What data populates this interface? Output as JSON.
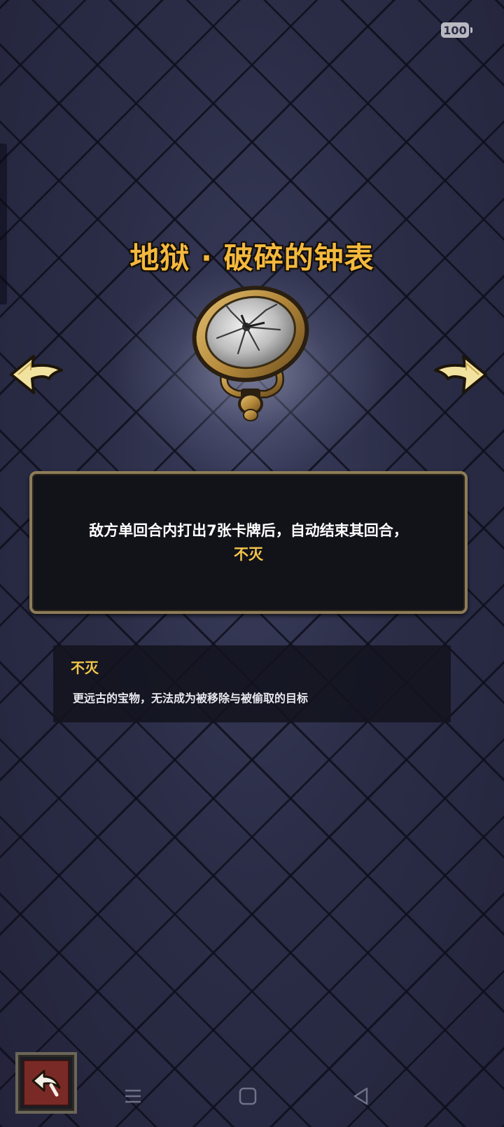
{
  "status_bar": {
    "battery": "100"
  },
  "relic": {
    "title": "地狱 · 破碎的钟表",
    "description": "敌方单回合内打出7张卡牌后，自动结束其回合，",
    "keyword_inline": "不灭"
  },
  "keyword_box": {
    "title": "不灭",
    "description": "更远古的宝物，无法成为被移除与被偷取的目标"
  },
  "icons": {
    "prev": "arrow-left-icon",
    "next": "arrow-right-icon",
    "back": "back-arrow-icon",
    "nav_menu": "menu-icon",
    "nav_home": "home-icon",
    "nav_back": "nav-back-icon"
  },
  "colors": {
    "title": "#f3b83d",
    "keyword": "#f3c64a",
    "panel_border": "#8d7c58",
    "back_button": "#7a2a26"
  }
}
